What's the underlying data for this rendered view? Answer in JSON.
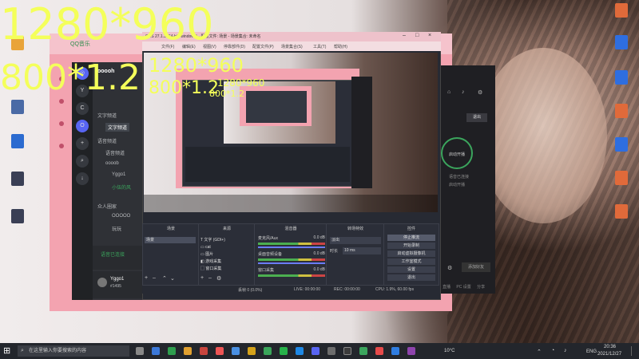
{
  "overlay": {
    "big_res": "1280*960",
    "big_scale": "800*1.2",
    "mid_res": "1280*960",
    "mid_scale": "800*1.2",
    "small_res": "1280*960",
    "small_scale": "800*1.2"
  },
  "qq": {
    "title": "QQ音乐"
  },
  "discord": {
    "channels_header": "文字频道",
    "channel_active": "文字频道",
    "voice_header": "语音频道",
    "voice_channel": "语音频道",
    "group": "oooob",
    "user1": "Yggo1",
    "user2": "小伍的风",
    "section3": "众人圈家",
    "item1": "OOOOO",
    "item2": "玩玩",
    "connected": "语音已连接",
    "username": "Yggo1",
    "user_tag": "#1495"
  },
  "obs": {
    "title": "OBS 27.1.3 (64-bit, windows) - 配置文件: 场景 - 场景集合: 未命名",
    "menu": [
      "文件(F)",
      "编辑(E)",
      "视图(V)",
      "停靠部件(D)",
      "配置文件(P)",
      "场景集合(S)",
      "工具(T)",
      "帮助(H)"
    ],
    "docks": {
      "scenes_title": "场景",
      "sources_title": "来源",
      "mixer_title": "混音器",
      "transitions_title": "转场特效",
      "controls_title": "控件"
    },
    "scene_item": "场景",
    "sources": [
      "文字 (GDI+)",
      "cat",
      "图片",
      "游戏采集",
      "窗口采集"
    ],
    "mixer": [
      {
        "name": "麦克风/Aux",
        "db": "0.0 dB"
      },
      {
        "name": "桌面音频设备",
        "db": "0.0 dB"
      },
      {
        "name": "窗口采集",
        "db": "0.0 dB"
      }
    ],
    "transition": "淡出",
    "duration_label": "时长",
    "duration": "10 ms",
    "controls": [
      "停止推流",
      "开始录制",
      "启动虚拟摄像机",
      "工作室模式",
      "设置",
      "退出"
    ],
    "status": {
      "dropped": "丢帧 0 (0.0%)",
      "live": "LIVE: 00:00:00",
      "rec": "REC: 00:00:00",
      "cpu": "CPU: 1.9%, 60.00 fps"
    }
  },
  "right_app": {
    "button_top": "退出",
    "circle_label": "启动开播",
    "caption1": "语音已连接",
    "caption2": "启动开播",
    "bottom_button": "添加好友",
    "footer": [
      "直播",
      "PC 设置",
      "分享"
    ]
  },
  "taskbar": {
    "search_placeholder": "在这里输入你要搜索的内容",
    "weather": "10°C",
    "lang": "ENG",
    "time": "20:36",
    "date": "2021/12/27"
  },
  "colors": {
    "overlay_text": "#f4ff5a",
    "pink": "#f3a3b0",
    "taskbar": "#23262c"
  }
}
